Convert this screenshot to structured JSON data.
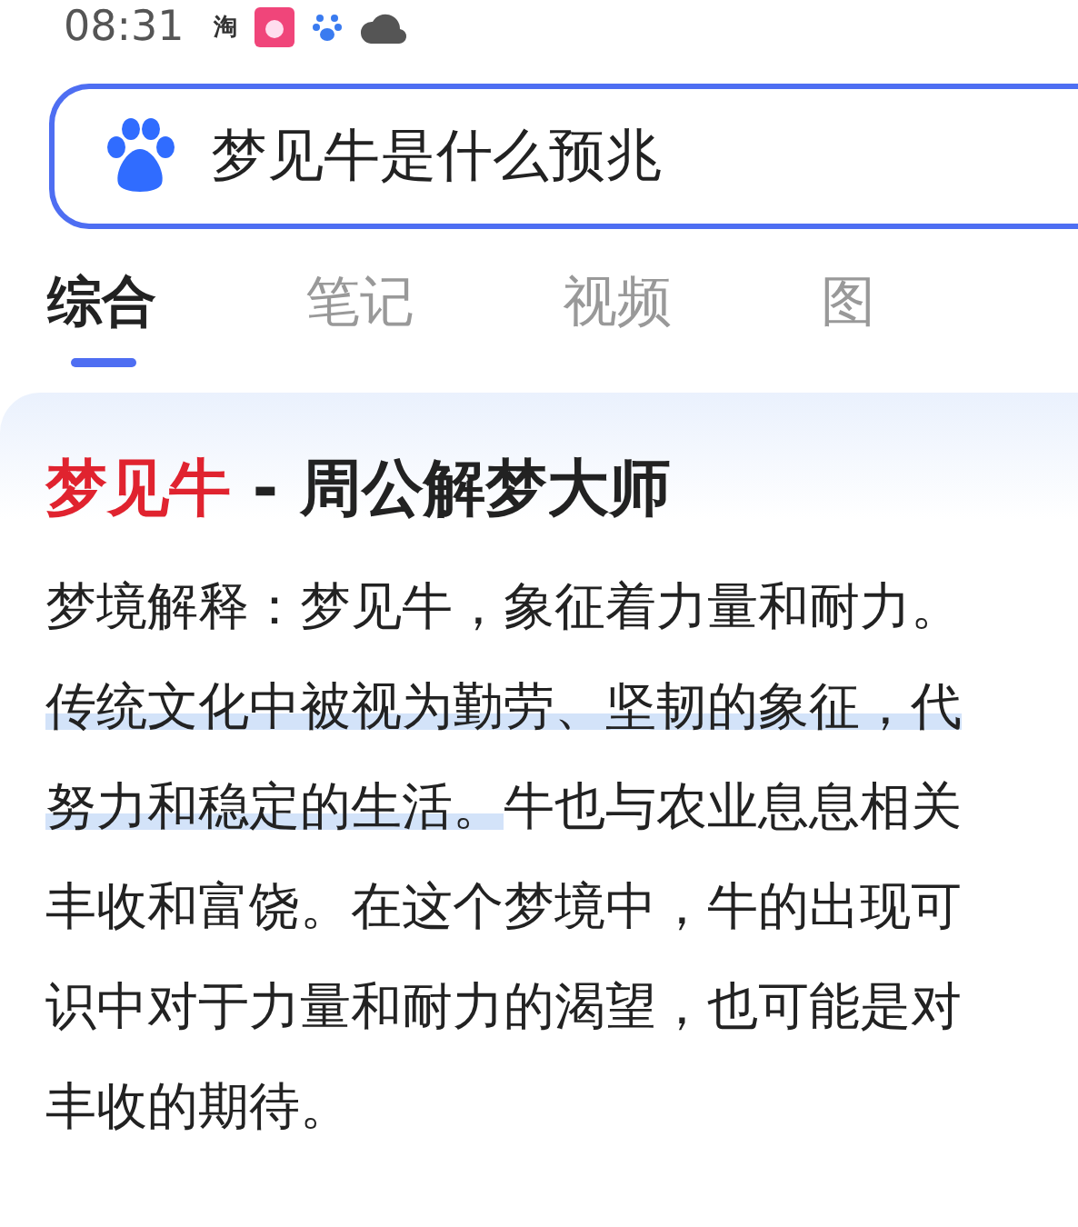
{
  "status_bar": {
    "time": "08:31",
    "app_glyph": "淘"
  },
  "search": {
    "value": "梦见牛是什么预兆"
  },
  "tabs": [
    {
      "label": "综合",
      "selected": true
    },
    {
      "label": "笔记",
      "selected": false
    },
    {
      "label": "视频",
      "selected": false
    },
    {
      "label": "图",
      "selected": false
    }
  ],
  "result": {
    "title_keyword": "梦见牛",
    "title_rest": " - 周公解梦大师",
    "lines": [
      [
        {
          "text": "梦境解释：梦见牛，象征着力量和耐力。",
          "highlighted": false
        }
      ],
      [
        {
          "text": "传统文化中被视为勤劳、坚韧的象征，代",
          "highlighted": true
        }
      ],
      [
        {
          "text": "努力和稳定的生活。",
          "highlighted": true
        },
        {
          "text": "牛也与农业息息相关",
          "highlighted": false
        }
      ],
      [
        {
          "text": "丰收和富饶。在这个梦境中，牛的出现可",
          "highlighted": false
        }
      ],
      [
        {
          "text": "识中对于力量和耐力的渴望，也可能是对",
          "highlighted": false
        }
      ],
      [
        {
          "text": "丰收的期待。",
          "highlighted": false
        }
      ]
    ]
  }
}
